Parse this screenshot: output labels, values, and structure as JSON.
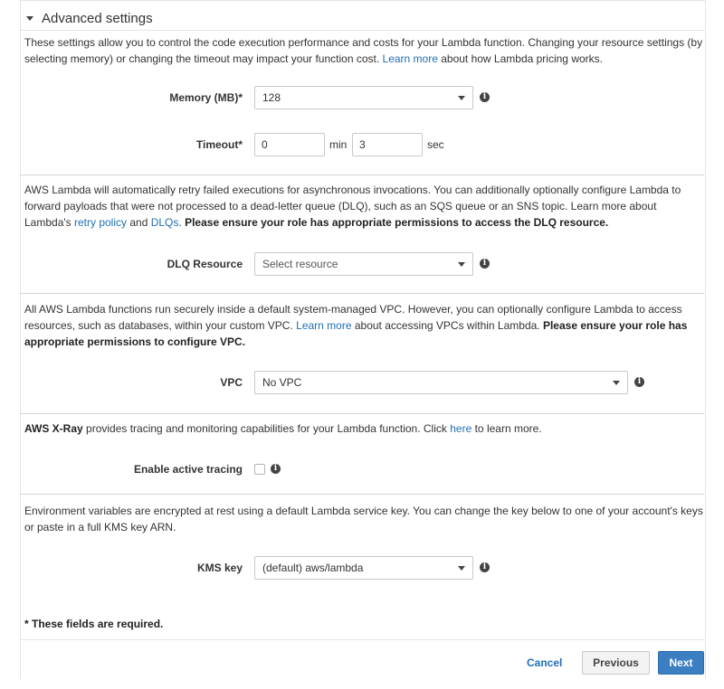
{
  "section": {
    "title": "Advanced settings"
  },
  "intro": {
    "text1": "These settings allow you to control the code execution performance and costs for your Lambda function. Changing your resource settings (by selecting memory) or changing the timeout may impact your function cost. ",
    "link": "Learn more",
    "text2": " about how Lambda pricing works."
  },
  "memory": {
    "label": "Memory (MB)*",
    "value": "128"
  },
  "timeout": {
    "label": "Timeout*",
    "minutes": "0",
    "min_unit": "min",
    "seconds": "3",
    "sec_unit": "sec"
  },
  "dlq_info": {
    "text1": "AWS Lambda will automatically retry failed executions for asynchronous invocations. You can additionally optionally configure Lambda to forward payloads that were not processed to a dead-letter queue (DLQ), such as an SQS queue or an SNS topic. Learn more about Lambda's ",
    "link1": "retry policy",
    "text2": " and ",
    "link2": "DLQs",
    "text3": ". ",
    "bold": "Please ensure your role has appropriate permissions to access the DLQ resource."
  },
  "dlq": {
    "label": "DLQ Resource",
    "placeholder": "Select resource"
  },
  "vpc_info": {
    "text1": "All AWS Lambda functions run securely inside a default system-managed VPC. However, you can optionally configure Lambda to access resources, such as databases, within your custom VPC. ",
    "link": "Learn more",
    "text2": " about accessing VPCs within Lambda. ",
    "bold": "Please ensure your role has appropriate permissions to configure VPC."
  },
  "vpc": {
    "label": "VPC",
    "value": "No VPC"
  },
  "xray_info": {
    "bold": "AWS X-Ray",
    "text1": " provides tracing and monitoring capabilities for your Lambda function. Click ",
    "link": "here",
    "text2": " to learn more."
  },
  "tracing": {
    "label": "Enable active tracing"
  },
  "env_info": {
    "text": "Environment variables are encrypted at rest using a default Lambda service key. You can change the key below to one of your account's keys or paste in a full KMS key ARN."
  },
  "kms": {
    "label": "KMS key",
    "value": "(default) aws/lambda"
  },
  "required_note": "* These fields are required.",
  "footer": {
    "cancel": "Cancel",
    "previous": "Previous",
    "next": "Next"
  }
}
